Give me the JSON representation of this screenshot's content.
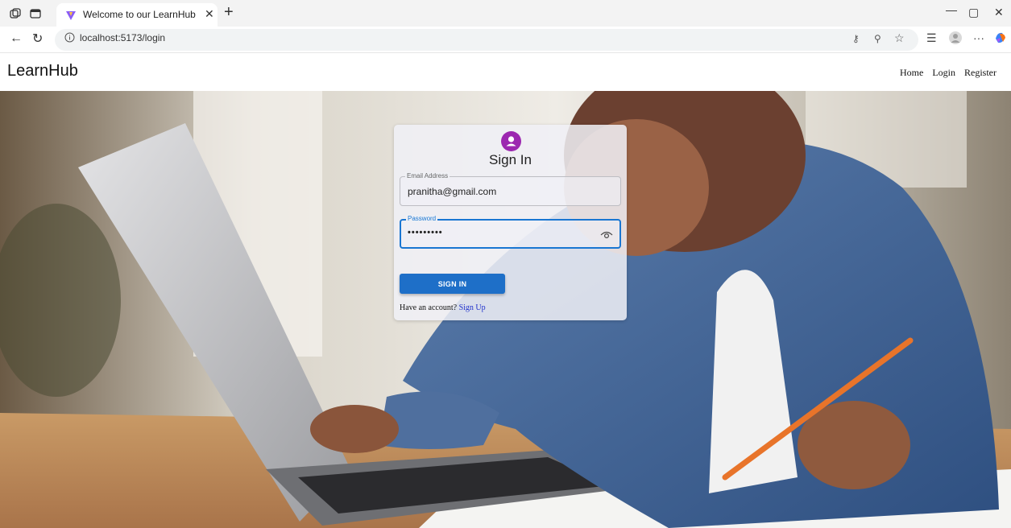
{
  "browser": {
    "tab_title": "Welcome to our LearnHub",
    "url": "localhost:5173/login"
  },
  "navbar": {
    "brand": "LearnHub",
    "links": [
      "Home",
      "Login",
      "Register"
    ]
  },
  "login": {
    "title": "Sign In",
    "email_label": "Email Address",
    "email_value": "pranitha@gmail.com",
    "password_label": "Password",
    "password_value": "•••••••••",
    "submit_label": "SIGN IN",
    "signup_prompt": "Have an account?",
    "signup_link": "Sign Up"
  },
  "colors": {
    "primary": "#1976d2",
    "avatar": "#9c27b0"
  }
}
